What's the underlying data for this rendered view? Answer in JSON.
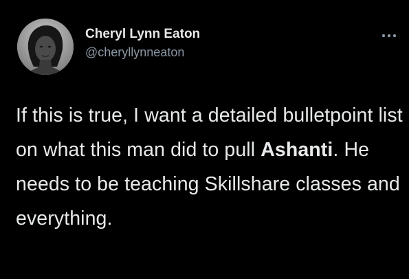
{
  "author": {
    "display_name": "Cheryl Lynn Eaton",
    "handle": "@cheryllynneaton"
  },
  "tweet": {
    "text_before": "If this is true, I want a detailed bulletpoint list on what this man did to pull ",
    "emphasis": "Ashanti",
    "text_after": ". He needs to be teaching Skillshare classes and everything."
  },
  "icons": {
    "more": "more-horizontal-icon"
  },
  "colors": {
    "background": "#000000",
    "primary_text": "#e7e9ea",
    "secondary_text": "#8b98a5"
  }
}
